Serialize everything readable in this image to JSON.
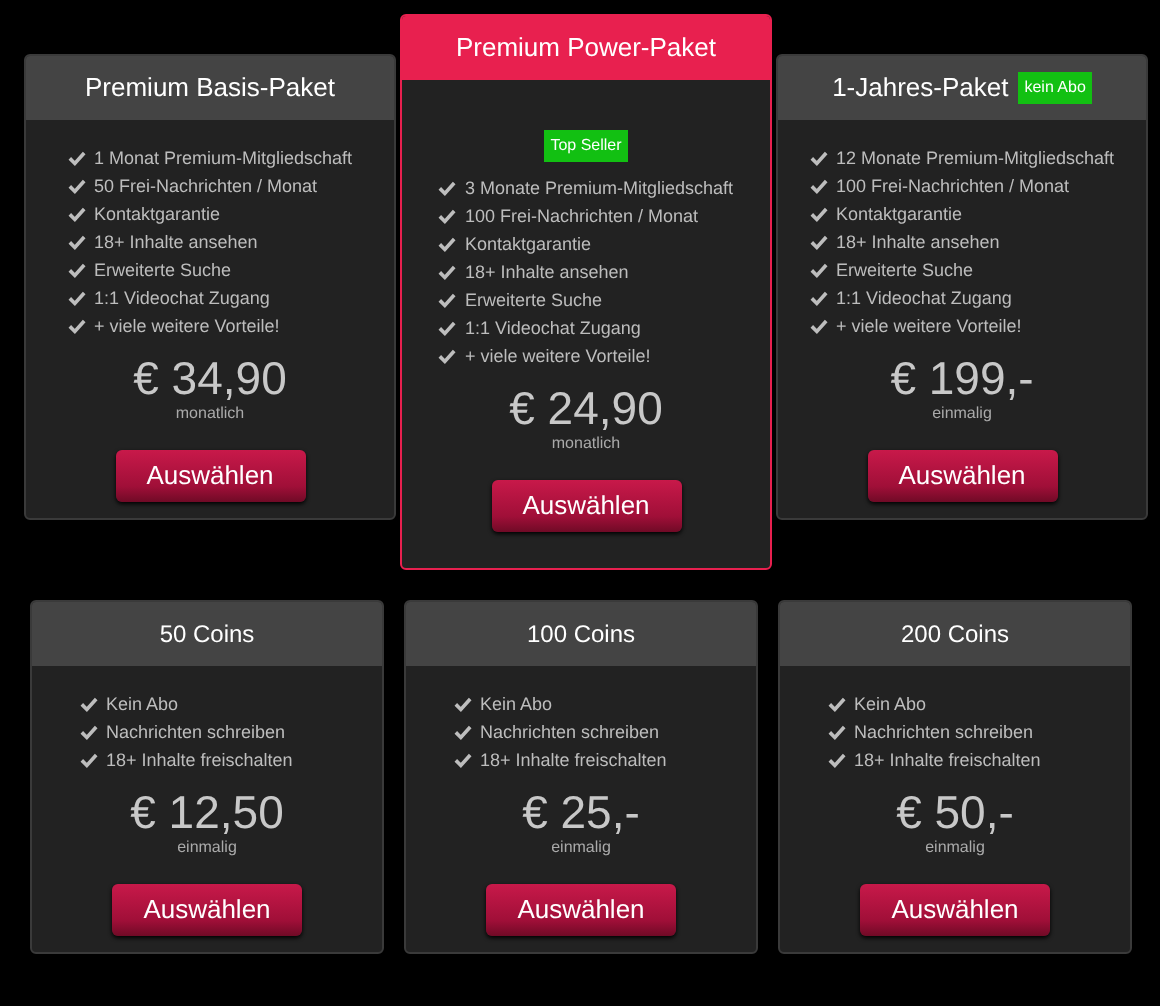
{
  "packages": [
    {
      "title": "Premium Basis-Paket",
      "featured": false,
      "features": [
        "1 Monat Premium-Mitgliedschaft",
        "50 Frei-Nachrichten / Monat",
        "Kontaktgarantie",
        "18+ Inhalte ansehen",
        "Erweiterte Suche",
        "1:1 Videochat Zugang",
        "+ viele weitere Vorteile!"
      ],
      "price": "€ 34,90",
      "period": "monatlich",
      "button": "Auswählen"
    },
    {
      "title": "Premium Power-Paket",
      "featured": true,
      "badge": "Top Seller",
      "features": [
        "3 Monate Premium-Mitgliedschaft",
        "100 Frei-Nachrichten / Monat",
        "Kontaktgarantie",
        "18+ Inhalte ansehen",
        "Erweiterte Suche",
        "1:1 Videochat Zugang",
        "+ viele weitere Vorteile!"
      ],
      "price": "€ 24,90",
      "period": "monatlich",
      "button": "Auswählen"
    },
    {
      "title": "1-Jahres-Paket",
      "featured": false,
      "title_badge": "kein Abo",
      "features": [
        "12 Monate Premium-Mitgliedschaft",
        "100 Frei-Nachrichten / Monat",
        "Kontaktgarantie",
        "18+ Inhalte ansehen",
        "Erweiterte Suche",
        "1:1 Videochat Zugang",
        "+ viele weitere Vorteile!"
      ],
      "price": "€ 199,-",
      "period": "einmalig",
      "button": "Auswählen"
    }
  ],
  "coins": [
    {
      "title": "50 Coins",
      "features": [
        "Kein Abo",
        "Nachrichten schreiben",
        "18+ Inhalte freischalten"
      ],
      "price": "€ 12,50",
      "period": "einmalig",
      "button": "Auswählen"
    },
    {
      "title": "100 Coins",
      "features": [
        "Kein Abo",
        "Nachrichten schreiben",
        "18+ Inhalte freischalten"
      ],
      "price": "€ 25,-",
      "period": "einmalig",
      "button": "Auswählen"
    },
    {
      "title": "200 Coins",
      "features": [
        "Kein Abo",
        "Nachrichten schreiben",
        "18+ Inhalte freischalten"
      ],
      "price": "€ 50,-",
      "period": "einmalig",
      "button": "Auswählen"
    }
  ]
}
